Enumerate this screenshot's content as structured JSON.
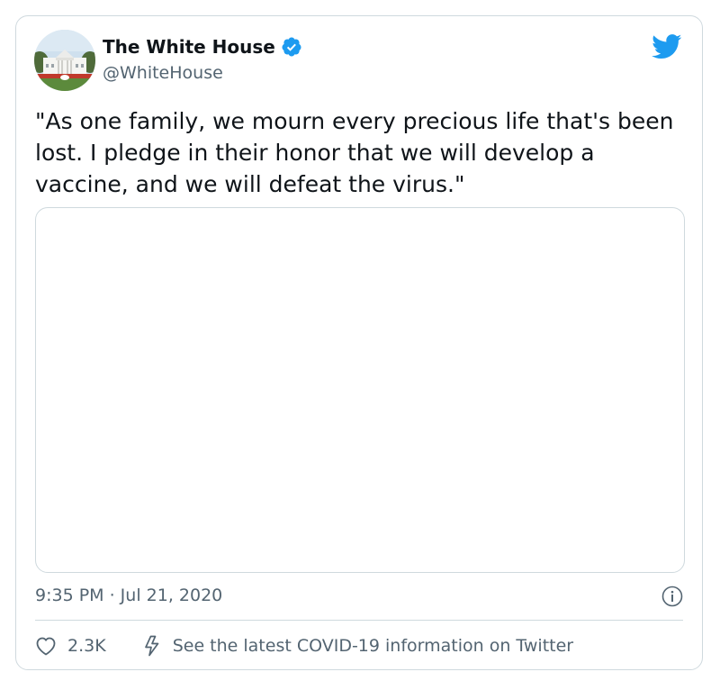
{
  "tweet": {
    "author_name": "The White House",
    "handle": "@WhiteHouse",
    "text": "\"As one family, we mourn every precious life that's been lost. I pledge in their honor that we will develop a vaccine, and we will defeat the virus.\"",
    "timestamp": "9:35 PM · Jul 21, 2020",
    "like_count": "2.3K",
    "covid_link": "See the latest COVID-19 information on Twitter"
  },
  "colors": {
    "twitter_blue": "#1d9bf0",
    "secondary_text": "#536471",
    "border": "#cfd9de"
  },
  "icons": [
    "verified-badge-icon",
    "twitter-bird-icon",
    "info-icon",
    "heart-icon",
    "lightning-icon"
  ]
}
